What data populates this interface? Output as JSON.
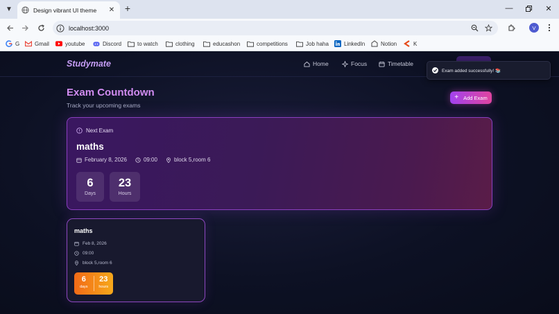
{
  "browser": {
    "tab_title": "Design vibrant UI theme",
    "url": "localhost:3000",
    "profile_initial": "V",
    "bookmarks": [
      {
        "label": "G",
        "icon": "google-icon"
      },
      {
        "label": "Gmail",
        "icon": "gmail-icon"
      },
      {
        "label": "youtube",
        "icon": "youtube-icon"
      },
      {
        "label": "Discord",
        "icon": "discord-icon"
      },
      {
        "label": "to watch",
        "icon": "folder-icon"
      },
      {
        "label": "clothing",
        "icon": "folder-icon"
      },
      {
        "label": "educashon",
        "icon": "folder-icon"
      },
      {
        "label": "competitions",
        "icon": "folder-icon"
      },
      {
        "label": "Job haha",
        "icon": "folder-icon"
      },
      {
        "label": "LinkedIn",
        "icon": "linkedin-icon"
      },
      {
        "label": "Notion",
        "icon": "notion-icon"
      },
      {
        "label": "K",
        "icon": "k-icon"
      }
    ]
  },
  "app": {
    "brand": "Studymate",
    "nav": [
      {
        "label": "Home",
        "icon": "home-icon"
      },
      {
        "label": "Focus",
        "icon": "sparkle-icon"
      },
      {
        "label": "Timetable",
        "icon": "calendar-icon"
      }
    ],
    "heading": "Exam Countdown",
    "subheading": "Track your upcoming exams",
    "add_button": "Add Exam",
    "toast": "Exam added successfully! 📚",
    "next_exam": {
      "label": "Next Exam",
      "subject": "maths",
      "date": "February 8, 2026",
      "time": "09:00",
      "location": "block 5,room 6",
      "days": "6",
      "days_label": "Days",
      "hours": "23",
      "hours_label": "Hours"
    },
    "exams": [
      {
        "subject": "maths",
        "date": "Feb 8, 2026",
        "time": "09:00",
        "location": "block 5,room 6",
        "days": "6",
        "days_label": "days",
        "hours": "23",
        "hours_label": "hours"
      }
    ]
  },
  "colors": {
    "accent_purple": "#a243ee",
    "accent_pink": "#e0449f",
    "countdown_orange": "#f26a17"
  }
}
